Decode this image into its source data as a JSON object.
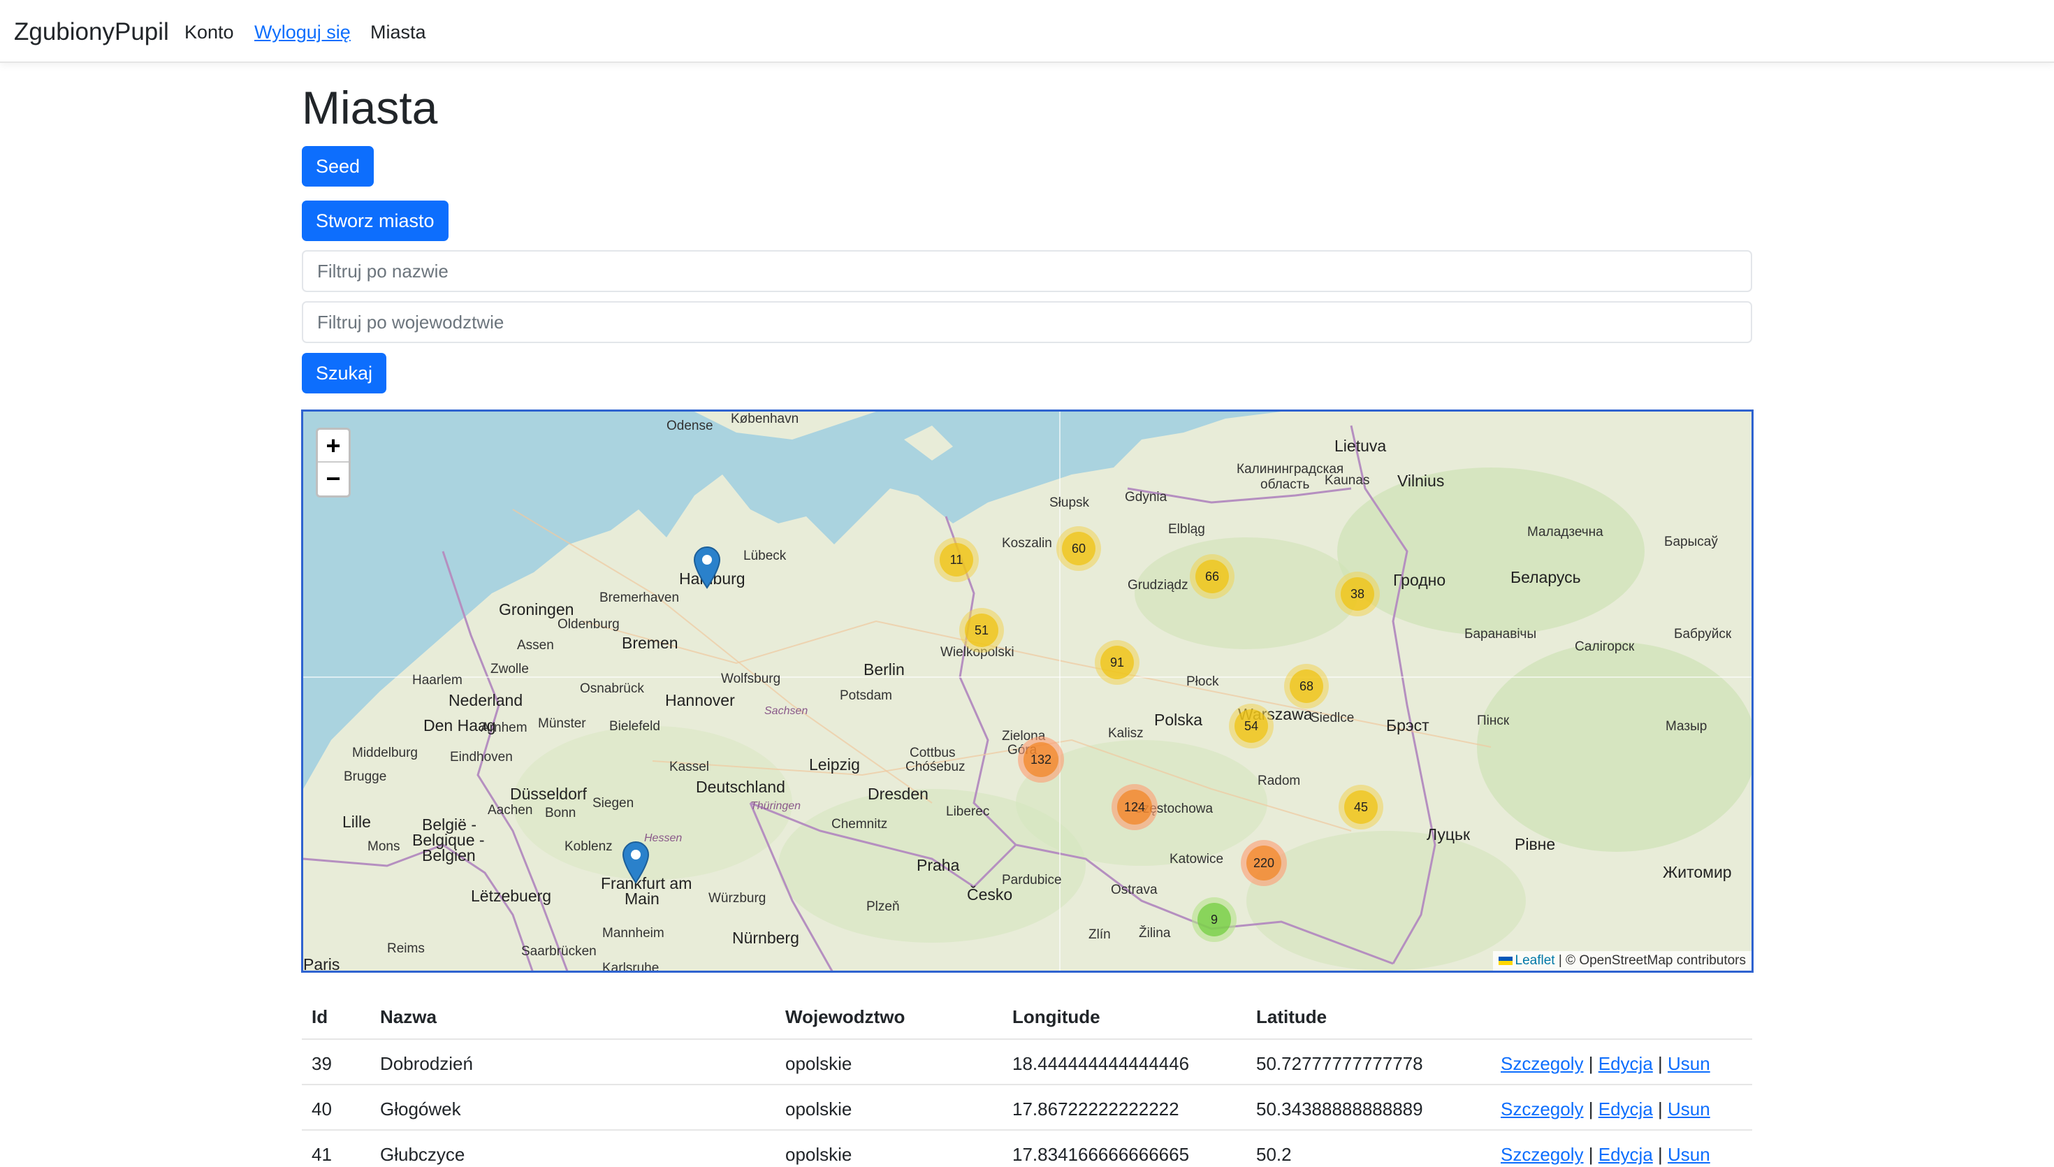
{
  "navbar": {
    "brand": "ZgubionyPupil",
    "links": [
      "Konto",
      "Wyloguj się",
      "Miasta"
    ]
  },
  "page": {
    "title": "Miasta",
    "seed_button": "Seed",
    "create_button": "Stworz miasto",
    "filter_name_placeholder": "Filtruj po nazwie",
    "filter_woj_placeholder": "Filtruj po wojewodztwie",
    "search_button": "Szukaj"
  },
  "map": {
    "zoom_in": "+",
    "zoom_out": "−",
    "attribution_leaflet": "Leaflet",
    "attribution_rest": "| © OpenStreetMap contributors",
    "clusters": [
      {
        "count": "11",
        "color": "yellow"
      },
      {
        "count": "60",
        "color": "yellow"
      },
      {
        "count": "66",
        "color": "yellow"
      },
      {
        "count": "38",
        "color": "yellow"
      },
      {
        "count": "51",
        "color": "yellow"
      },
      {
        "count": "91",
        "color": "yellow"
      },
      {
        "count": "68",
        "color": "yellow"
      },
      {
        "count": "54",
        "color": "yellow"
      },
      {
        "count": "132",
        "color": "orange"
      },
      {
        "count": "124",
        "color": "orange"
      },
      {
        "count": "45",
        "color": "yellow"
      },
      {
        "count": "220",
        "color": "orange"
      },
      {
        "count": "9",
        "color": "green"
      }
    ],
    "places": {
      "kobenhavn": "København",
      "odense": "Odense",
      "lubeck": "Lübeck",
      "hamburg": "Hamburg",
      "bremerhaven": "Bremerhaven",
      "groningen": "Groningen",
      "oldenburg": "Oldenburg",
      "bremen": "Bremen",
      "assen": "Assen",
      "zwolle": "Zwolle",
      "haarlem": "Haarlem",
      "nederland": "Nederland",
      "osnabruck": "Osnabrück",
      "wolfsburg": "Wolfsburg",
      "hannover": "Hannover",
      "berlin": "Berlin",
      "potsdam": "Potsdam",
      "denhaag": "Den Haag",
      "arnhem": "Arnhem",
      "munster": "Münster",
      "bielefeld": "Bielefeld",
      "middelburg": "Middelburg",
      "eindhoven": "Eindhoven",
      "kassel": "Kassel",
      "leipzig": "Leipzig",
      "cottbus": "Cottbus",
      "chosebuz": "Chóśebuz",
      "brugge": "Brugge",
      "dusseldorf": "Düsseldorf",
      "deutschland": "Deutschland",
      "dresden": "Dresden",
      "lille": "Lille",
      "aachen": "Aachen",
      "bonn": "Bonn",
      "siegen": "Siegen",
      "chemnitz": "Chemnitz",
      "belgie": "België -",
      "belgique": "Belgique -",
      "belgien": "Belgien",
      "koblenz": "Koblenz",
      "mons": "Mons",
      "frankfurt": "Frankfurt am",
      "main": "Main",
      "praha": "Praha",
      "cesko": "Česko",
      "letzebuerg": "Lëtzebuerg",
      "wurzburg": "Würzburg",
      "plzen": "Plzeň",
      "mannheim": "Mannheim",
      "reims": "Reims",
      "saarbrucken": "Saarbrücken",
      "nurnberg": "Nürnberg",
      "paris": "Paris",
      "karlsruhe": "Karlsruhe",
      "slupsk": "Słupsk",
      "gdynia": "Gdynia",
      "koszalin": "Koszalin",
      "elblag": "Elbląg",
      "grudziadz": "Grudziądz",
      "kaliningrad": "Калининградская",
      "oblast": "область",
      "lietuva": "Lietuva",
      "kaunas": "Kaunas",
      "vilnius": "Vilnius",
      "grodno": "Гродно",
      "belarus": "Беларусь",
      "plock": "Płock",
      "warszawa": "Warszawa",
      "siedlce": "Siedlce",
      "polska": "Polska",
      "brest": "Брэст",
      "pinsk": "Пінск",
      "kalisz": "Kalisz",
      "zielona": "Zielona",
      "gora": "Góra",
      "radom": "Radom",
      "czestochowa": "Częstochowa",
      "liberec": "Liberec",
      "katowice": "Katowice",
      "pardubice": "Pardubice",
      "ostrava": "Ostrava",
      "zilina": "Žilina",
      "zlin": "Zlín",
      "lutsk": "Луцьк",
      "rivne": "Рівне",
      "zhytomyr": "Житомир",
      "baranavichy": "Баранавічы",
      "salihorsk": "Салігорск",
      "mazyr": "Мазыр",
      "babruysk": "Бабруйск",
      "molodechno": "Маладзечна",
      "barysaw": "Барысаў",
      "wielkopolski": "Wielkopolski",
      "hessen": "Hessen",
      "sachsen": "Sachsen",
      "thuringen": "Thüringen"
    }
  },
  "table": {
    "headers": [
      "Id",
      "Nazwa",
      "Wojewodztwo",
      "Longitude",
      "Latitude"
    ],
    "rows": [
      {
        "id": "39",
        "name": "Dobrodzień",
        "woj": "opolskie",
        "lon": "18.444444444444446",
        "lat": "50.72777777777778"
      },
      {
        "id": "40",
        "name": "Głogówek",
        "woj": "opolskie",
        "lon": "17.86722222222222",
        "lat": "50.34388888888889"
      },
      {
        "id": "41",
        "name": "Głubczyce",
        "woj": "opolskie",
        "lon": "17.834166666666665",
        "lat": "50.2"
      }
    ],
    "actions": {
      "details": "Szczegoly",
      "edit": "Edycja",
      "delete": "Usun",
      "sep": "|"
    }
  }
}
